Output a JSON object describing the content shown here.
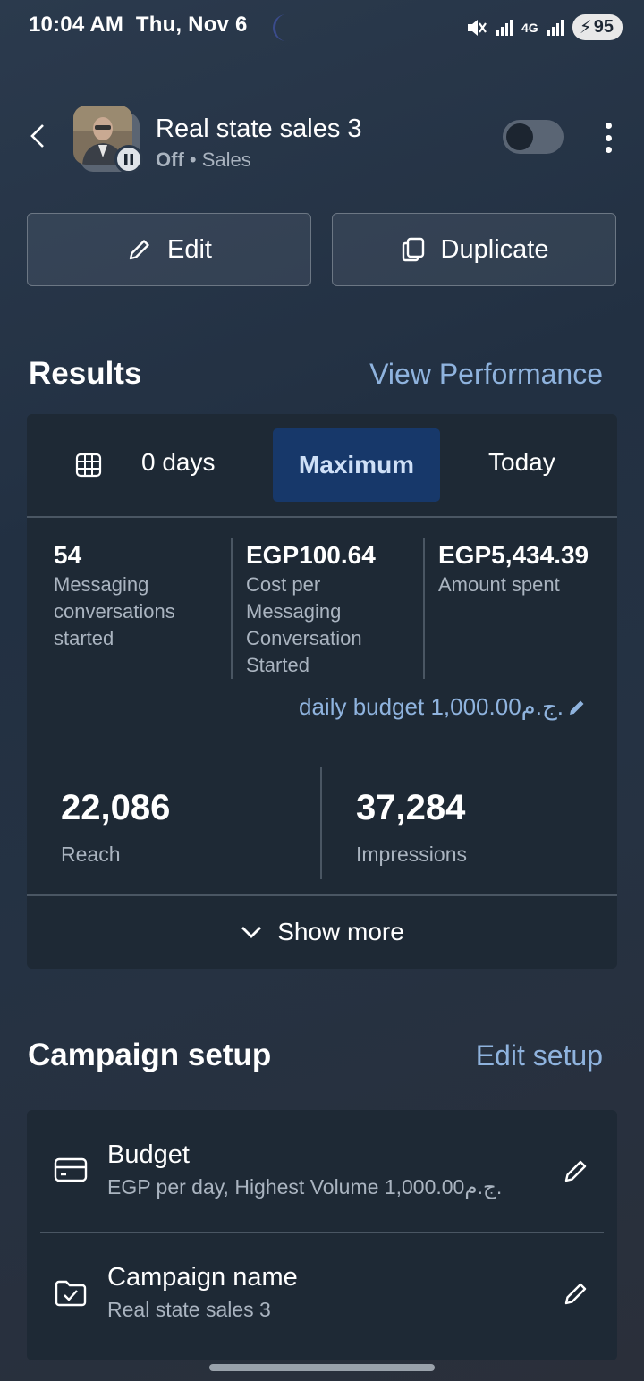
{
  "status_bar": {
    "time": "10:04 AM",
    "date": "Thu, Nov 6",
    "network": "4G",
    "battery": "95"
  },
  "header": {
    "campaign_name": "Real state sales 3",
    "status": "Off",
    "separator": "•",
    "objective": "Sales",
    "toggle_on": false
  },
  "actions": {
    "edit_label": "Edit",
    "duplicate_label": "Duplicate"
  },
  "results": {
    "title": "Results",
    "view_performance": "View Performance",
    "segments": [
      {
        "label": "0 days",
        "selected": false
      },
      {
        "label": "Maximum",
        "selected": true
      },
      {
        "label": "Today",
        "selected": false
      }
    ],
    "metrics": [
      {
        "value": "54",
        "label": "Messaging conversations started"
      },
      {
        "value": "EGP100.64",
        "label": "Cost per Messaging Conversation Started"
      },
      {
        "value": "EGP5,434.39",
        "label": "Amount spent"
      }
    ],
    "daily_budget": "daily budget 1,000.00ج.م.",
    "reach": {
      "value": "22,086",
      "label": "Reach"
    },
    "impressions": {
      "value": "37,284",
      "label": "Impressions"
    },
    "show_more": "Show more"
  },
  "setup": {
    "title": "Campaign setup",
    "edit_setup": "Edit setup",
    "items": [
      {
        "title": "Budget",
        "subtitle": "EGP per day, Highest Volume 1,000.00ج.م.",
        "icon": "credit-card-icon"
      },
      {
        "title": "Campaign name",
        "subtitle": "Real state sales 3",
        "icon": "folder-check-icon"
      }
    ]
  },
  "colors": {
    "accent_link": "#8fb3de",
    "selected_segment": "#17386a",
    "card_bg": "#1e2935"
  }
}
